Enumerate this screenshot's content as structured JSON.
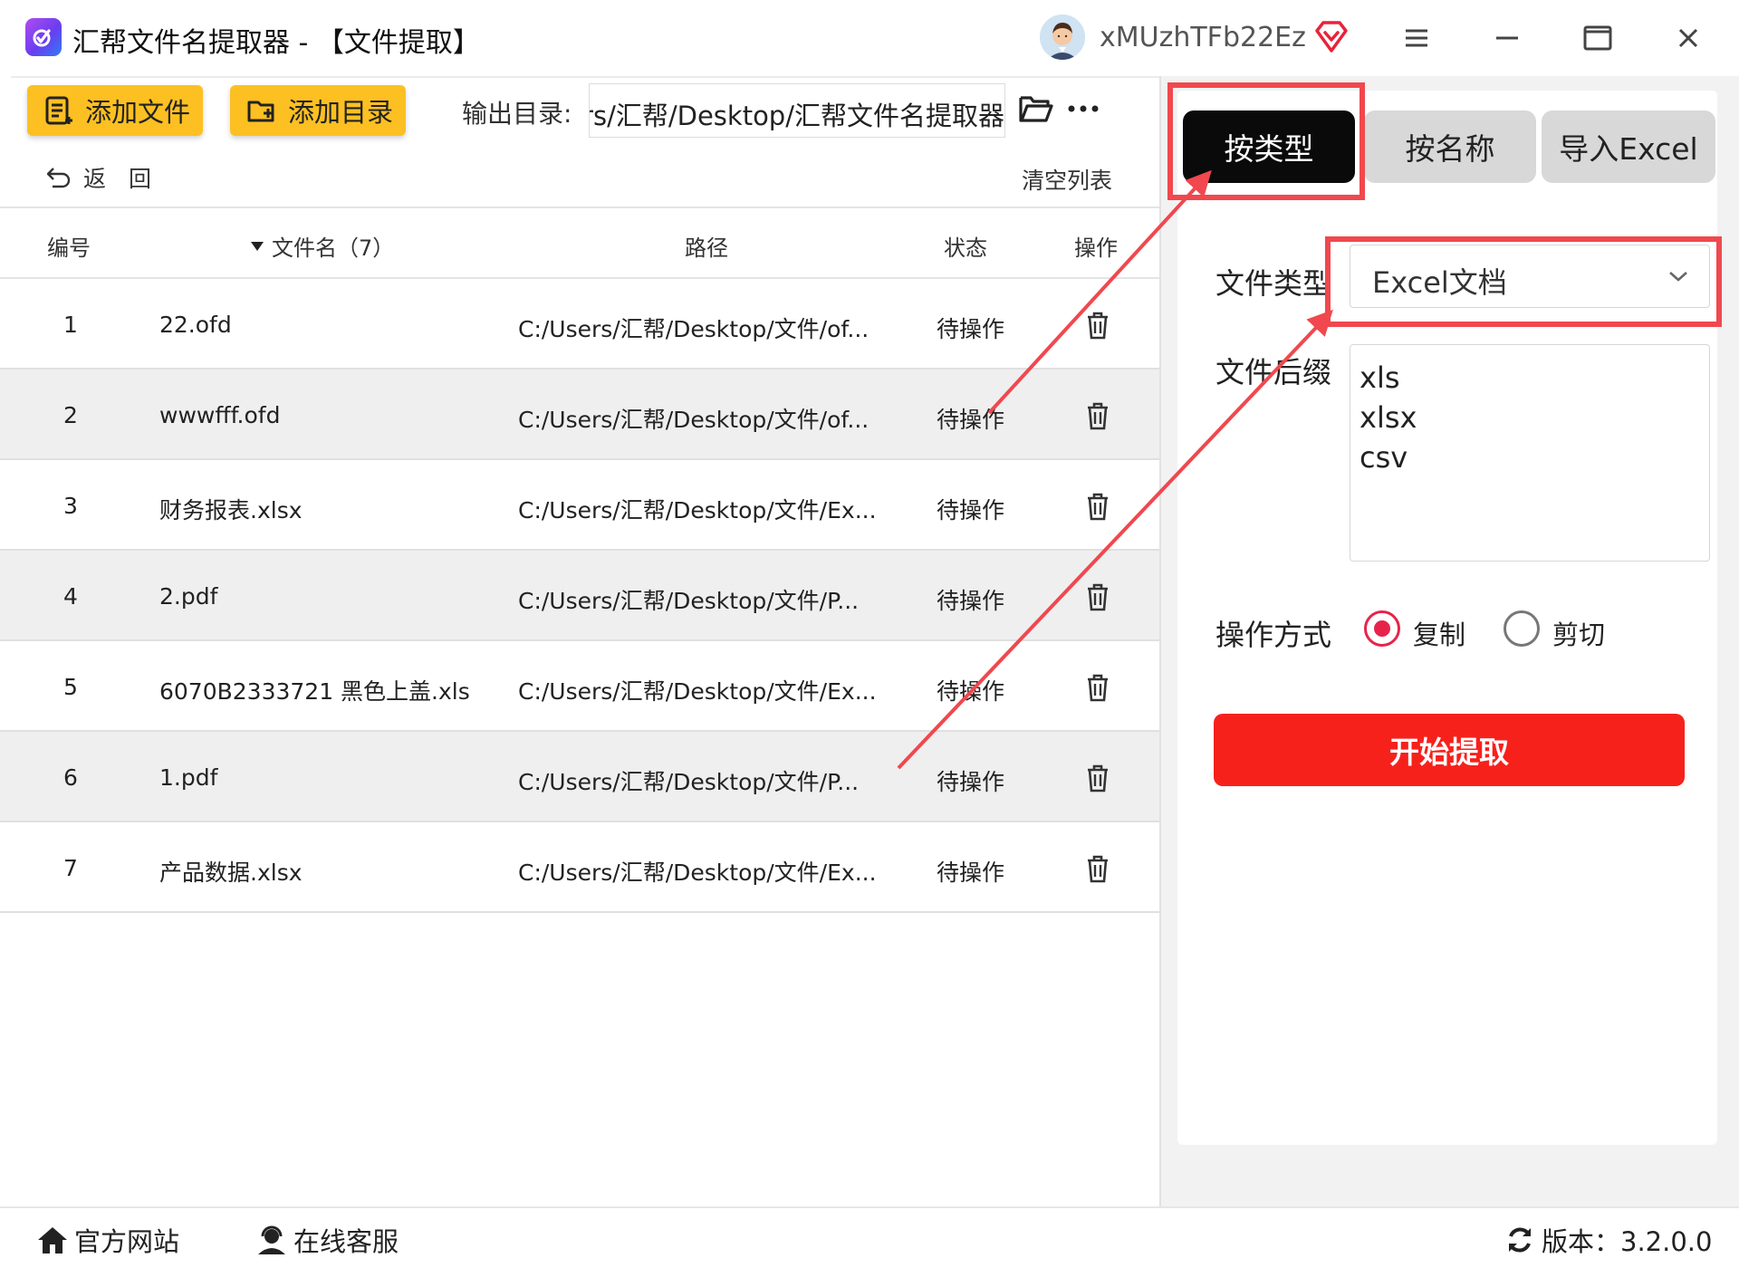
{
  "window": {
    "title": "汇帮文件名提取器 - 【文件提取】",
    "username": "xMUzhTFb22Ez"
  },
  "toolbar": {
    "add_file": "添加文件",
    "add_dir": "添加目录",
    "output_label": "输出目录:",
    "output_path": "C:/Users/汇帮/Desktop/汇帮文件名提取器",
    "back": "返　回",
    "clear": "清空列表"
  },
  "table": {
    "headers": {
      "num": "编号",
      "name": "文件名（7）",
      "path": "路径",
      "status": "状态",
      "op": "操作"
    },
    "rows": [
      {
        "num": "1",
        "name": "22.ofd",
        "path": "C:/Users/汇帮/Desktop/文件/of...",
        "status": "待操作"
      },
      {
        "num": "2",
        "name": "wwwfff.ofd",
        "path": "C:/Users/汇帮/Desktop/文件/of...",
        "status": "待操作"
      },
      {
        "num": "3",
        "name": "财务报表.xlsx",
        "path": "C:/Users/汇帮/Desktop/文件/Ex...",
        "status": "待操作"
      },
      {
        "num": "4",
        "name": "2.pdf",
        "path": "C:/Users/汇帮/Desktop/文件/P...",
        "status": "待操作"
      },
      {
        "num": "5",
        "name": "6070B2333721 黑色上盖.xls",
        "path": "C:/Users/汇帮/Desktop/文件/Ex...",
        "status": "待操作"
      },
      {
        "num": "6",
        "name": "1.pdf",
        "path": "C:/Users/汇帮/Desktop/文件/P...",
        "status": "待操作"
      },
      {
        "num": "7",
        "name": "产品数据.xlsx",
        "path": "C:/Users/汇帮/Desktop/文件/Ex...",
        "status": "待操作"
      }
    ]
  },
  "panel": {
    "tabs": {
      "by_type": "按类型",
      "by_name": "按名称",
      "import_excel": "导入Excel"
    },
    "file_type_label": "文件类型",
    "file_type_value": "Excel文档",
    "ext_label": "文件后缀",
    "extensions": [
      "xls",
      "xlsx",
      "csv"
    ],
    "mode_label": "操作方式",
    "mode_copy": "复制",
    "mode_cut": "剪切",
    "selected_mode": "复制",
    "start": "开始提取"
  },
  "footer": {
    "site": "官方网站",
    "service": "在线客服",
    "version": "版本：3.2.0.0"
  },
  "colors": {
    "accent_yellow": "#fdc022",
    "start_red": "#f7211c",
    "radio_red": "#e8234b",
    "annotation_red": "#f0484e",
    "active_tab": "#0a0a0a"
  }
}
